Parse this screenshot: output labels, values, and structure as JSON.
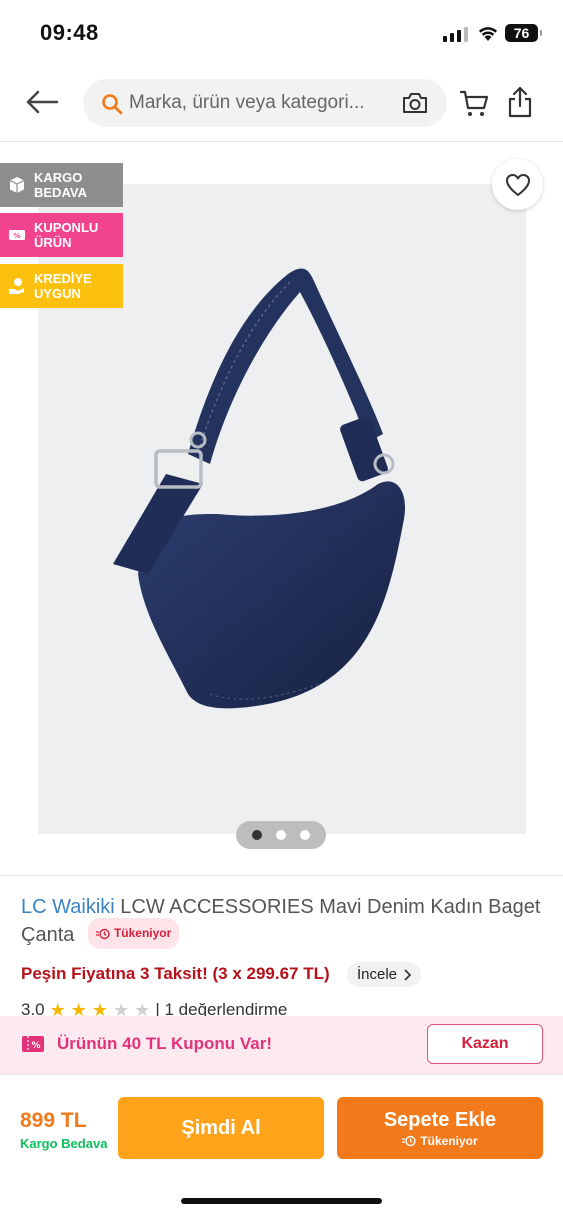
{
  "status_bar": {
    "time": "09:48",
    "battery": "76"
  },
  "header": {
    "search_placeholder": "Marka, ürün veya kategori..."
  },
  "badges": [
    {
      "line1": "KARGO",
      "line2": "BEDAVA",
      "color": "#8e8e8e"
    },
    {
      "line1": "KUPONLU",
      "line2": "ÜRÜN",
      "color": "#f2438f"
    },
    {
      "line1": "KREDİYE",
      "line2": "UYGUN",
      "color": "#fcc10f"
    }
  ],
  "gallery": {
    "total_images": 3,
    "active_index": 0
  },
  "product": {
    "brand": "LC Waikiki",
    "name": "LCW ACCESSORIES Mavi Denim Kadın Baget Çanta",
    "stock_status": "Tükeniyor",
    "installment": "Peşin Fiyatına 3 Taksit! (3 x 299.67 TL)",
    "inspect": "İncele",
    "rating_value": "3.0",
    "rating_stars": 3,
    "rating_count": "| 1 değerlendirme"
  },
  "coupon": {
    "text": "Ürünün 40 TL Kuponu Var!",
    "button": "Kazan"
  },
  "bottom_bar": {
    "price": "899 TL",
    "shipping": "Kargo Bedava",
    "buy_now": "Şimdi Al",
    "add_to_cart": "Sepete Ekle",
    "add_to_cart_sub": "Tükeniyor"
  },
  "colors": {
    "brand_blue": "#3a84c4",
    "accent_orange": "#f27a1a",
    "buy_now_orange": "#ffa31a",
    "red": "#b5121b",
    "pink": "#e2337a",
    "green": "#0bc15c"
  }
}
